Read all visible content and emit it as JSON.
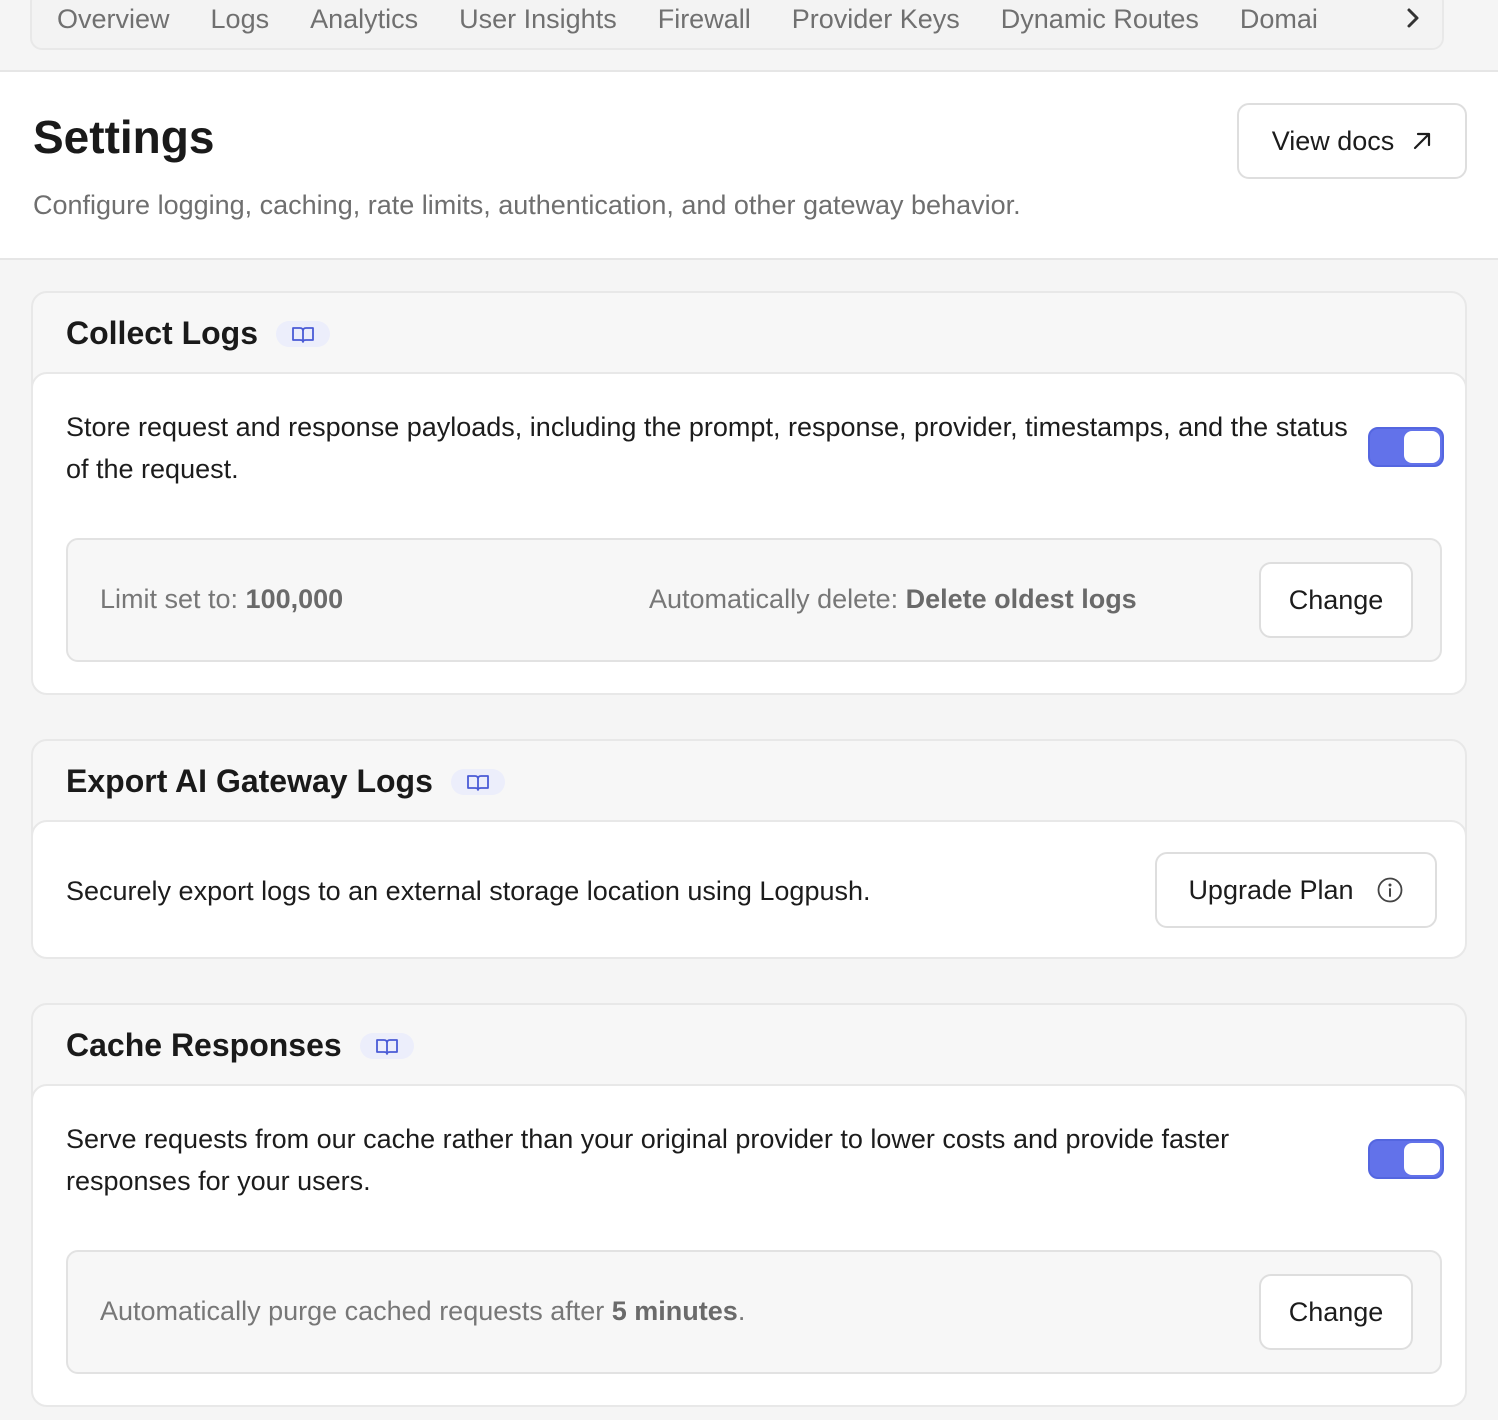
{
  "nav": {
    "tabs": [
      "Overview",
      "Logs",
      "Analytics",
      "User Insights",
      "Firewall",
      "Provider Keys",
      "Dynamic Routes",
      "Domai"
    ]
  },
  "header": {
    "title": "Settings",
    "subtitle": "Configure logging, caching, rate limits, authentication, and other gateway behavior.",
    "docs_label": "View docs"
  },
  "collect_logs": {
    "title": "Collect Logs",
    "description": "Store request and response payloads, including the prompt, response, provider, timestamps, and the status of the request.",
    "enabled": true,
    "limit_label": "Limit set to: ",
    "limit_value": "100,000",
    "delete_label": "Automatically delete: ",
    "delete_value": "Delete oldest logs",
    "change_label": "Change"
  },
  "export_logs": {
    "title": "Export AI Gateway Logs",
    "description": "Securely export logs to an external storage location using Logpush.",
    "upgrade_label": "Upgrade Plan"
  },
  "cache": {
    "title": "Cache Responses",
    "description": "Serve requests from our cache rather than your original provider to lower costs and provide faster responses for your users.",
    "enabled": true,
    "purge_prefix": "Automatically purge cached requests after ",
    "purge_value": "5 minutes",
    "purge_suffix": ".",
    "change_label": "Change"
  },
  "colors": {
    "accent": "#6272ea",
    "badge_bg": "#eceefb",
    "badge_icon": "#4a5bd6"
  },
  "icons": [
    "book-icon",
    "arrow-up-right-icon",
    "info-icon",
    "chevron-right-icon"
  ]
}
